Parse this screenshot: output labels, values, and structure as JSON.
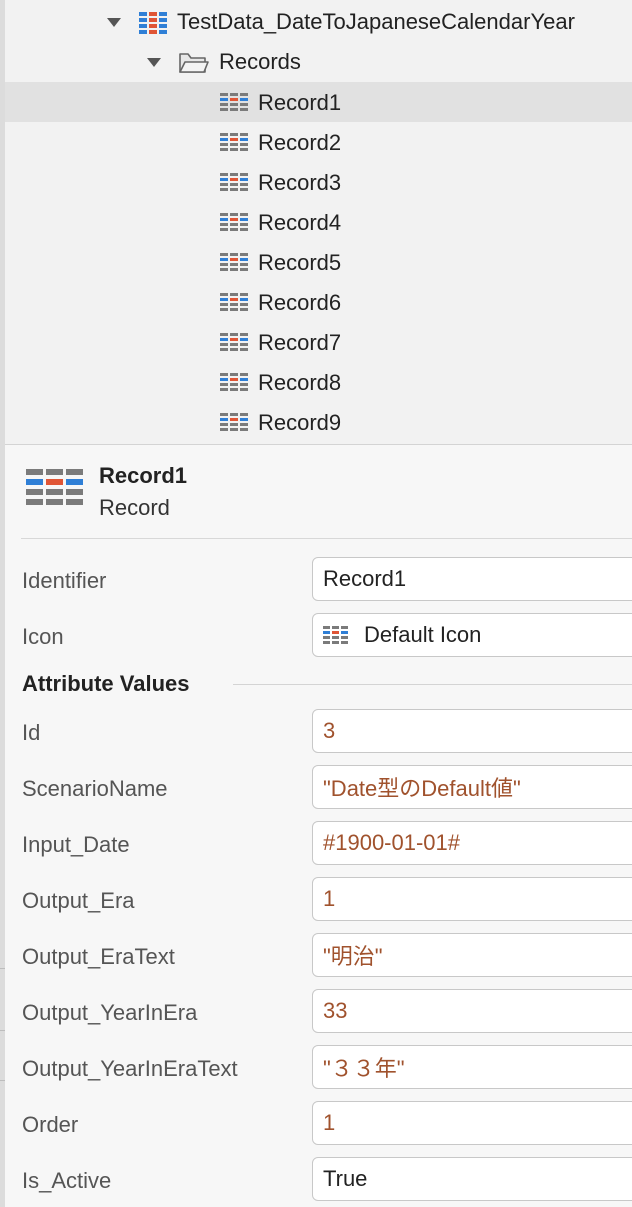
{
  "tree": {
    "root_label": "TestData_DateToJapaneseCalendarYear",
    "folder_label": "Records",
    "records": [
      "Record1",
      "Record2",
      "Record3",
      "Record4",
      "Record5",
      "Record6",
      "Record7",
      "Record8",
      "Record9"
    ],
    "selected_index": 0
  },
  "header": {
    "title": "Record1",
    "subtitle": "Record"
  },
  "properties": {
    "identifier_label": "Identifier",
    "identifier_value": "Record1",
    "icon_label": "Icon",
    "icon_value": "Default Icon",
    "section_title": "Attribute Values",
    "attributes": [
      {
        "label": "Id",
        "value": "3"
      },
      {
        "label": "ScenarioName",
        "value": "\"Date型のDefault値\""
      },
      {
        "label": "Input_Date",
        "value": "#1900-01-01#"
      },
      {
        "label": "Output_Era",
        "value": "1"
      },
      {
        "label": "Output_EraText",
        "value": "\"明治\""
      },
      {
        "label": "Output_YearInEra",
        "value": "33"
      },
      {
        "label": "Output_YearInEraText",
        "value": "\"３３年\""
      },
      {
        "label": "Order",
        "value": "1"
      },
      {
        "label": "Is_Active",
        "value": "True"
      }
    ]
  },
  "colors": {
    "expression_text": "#a0522d",
    "icon_blue": "#2f7fd6",
    "icon_red": "#e05535",
    "icon_gray": "#7b7b7b",
    "selected_row": "#e1e1e1"
  }
}
